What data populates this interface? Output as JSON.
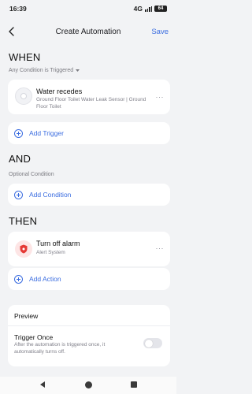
{
  "status_bar": {
    "time": "16:39",
    "network": "4G",
    "battery": "64"
  },
  "header": {
    "title": "Create Automation",
    "save_label": "Save"
  },
  "when": {
    "heading": "WHEN",
    "condition_selector": "Any Condition is Triggered",
    "trigger": {
      "title": "Water recedes",
      "subtitle": "Ground Floor Toilet Water Leak Sensor | Ground Floor Toilet",
      "more": "···"
    },
    "add_label": "Add Trigger"
  },
  "and": {
    "heading": "AND",
    "sublabel": "Optional Condition",
    "add_label": "Add Condition"
  },
  "then": {
    "heading": "THEN",
    "action": {
      "title": "Turn off alarm",
      "subtitle": "Alert System",
      "more": "···"
    },
    "add_label": "Add Action"
  },
  "preview": {
    "title": "Preview",
    "trigger_once_label": "Trigger Once",
    "trigger_once_desc": "After the automation is triggered once, it automatically turns off.",
    "trigger_once_enabled": false
  },
  "colors": {
    "accent": "#3b6de0",
    "alarm": "#e53935",
    "background": "#f2f3f5"
  },
  "icons": [
    "back-arrow-icon",
    "water-sensor-icon",
    "shield-alarm-icon",
    "plus-icon",
    "more-icon",
    "dropdown-caret-icon"
  ]
}
